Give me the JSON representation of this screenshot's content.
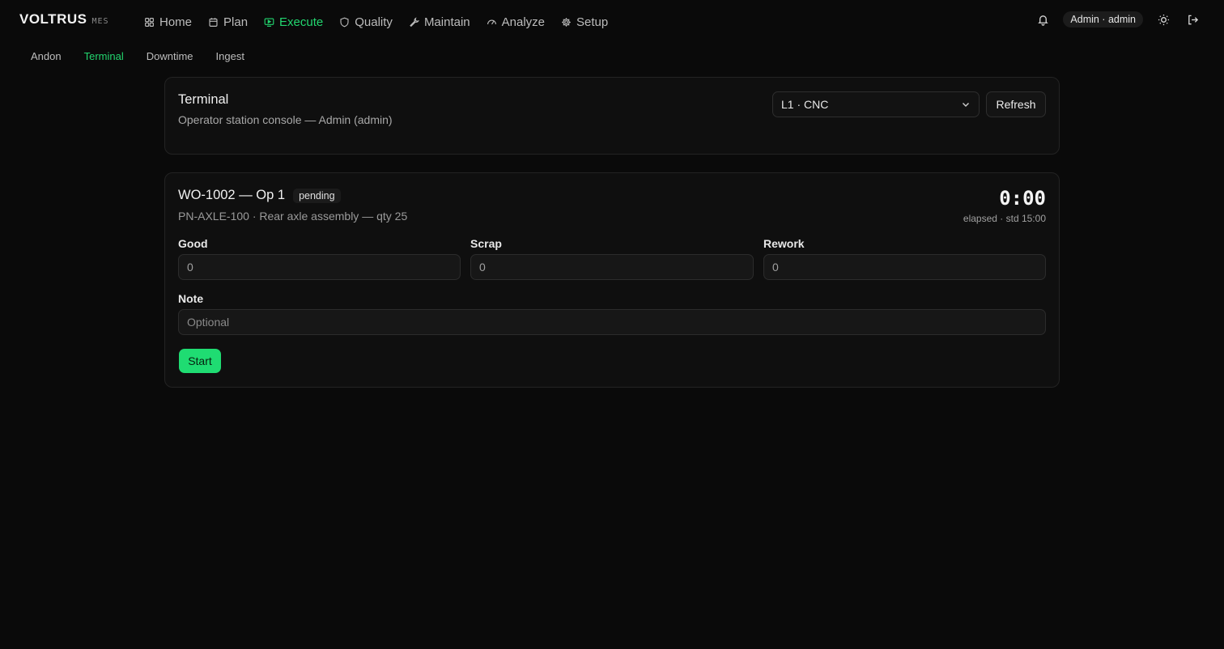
{
  "brand": {
    "name": "VOLTRUS",
    "tag": "MES"
  },
  "nav": {
    "items": [
      {
        "label": "Home",
        "icon": "grid-icon"
      },
      {
        "label": "Plan",
        "icon": "calendar-icon"
      },
      {
        "label": "Execute",
        "icon": "monitor-play-icon",
        "active": true
      },
      {
        "label": "Quality",
        "icon": "shield-icon"
      },
      {
        "label": "Maintain",
        "icon": "wrench-icon"
      },
      {
        "label": "Analyze",
        "icon": "gauge-icon"
      },
      {
        "label": "Setup",
        "icon": "gear-icon"
      }
    ]
  },
  "header": {
    "user_label": "Admin · admin"
  },
  "subnav": {
    "items": [
      {
        "label": "Andon"
      },
      {
        "label": "Terminal",
        "active": true
      },
      {
        "label": "Downtime"
      },
      {
        "label": "Ingest"
      }
    ]
  },
  "terminal": {
    "title": "Terminal",
    "subtitle": "Operator station console — Admin (admin)",
    "station": "L1 · CNC",
    "refresh_label": "Refresh"
  },
  "work_order": {
    "title": "WO-1002 — Op 1",
    "status": "pending",
    "subtitle": "PN-AXLE-100 · Rear axle assembly — qty 25",
    "elapsed": "0:00",
    "elapsed_label": "elapsed · std 15:00",
    "good_label": "Good",
    "good_value": "0",
    "scrap_label": "Scrap",
    "scrap_value": "0",
    "rework_label": "Rework",
    "rework_value": "0",
    "note_label": "Note",
    "note_placeholder": "Optional",
    "start_label": "Start"
  },
  "colors": {
    "accent": "#22d66f",
    "start_button": "#1fdc72",
    "background": "#0a0a0a",
    "card": "#0f0f0f"
  }
}
